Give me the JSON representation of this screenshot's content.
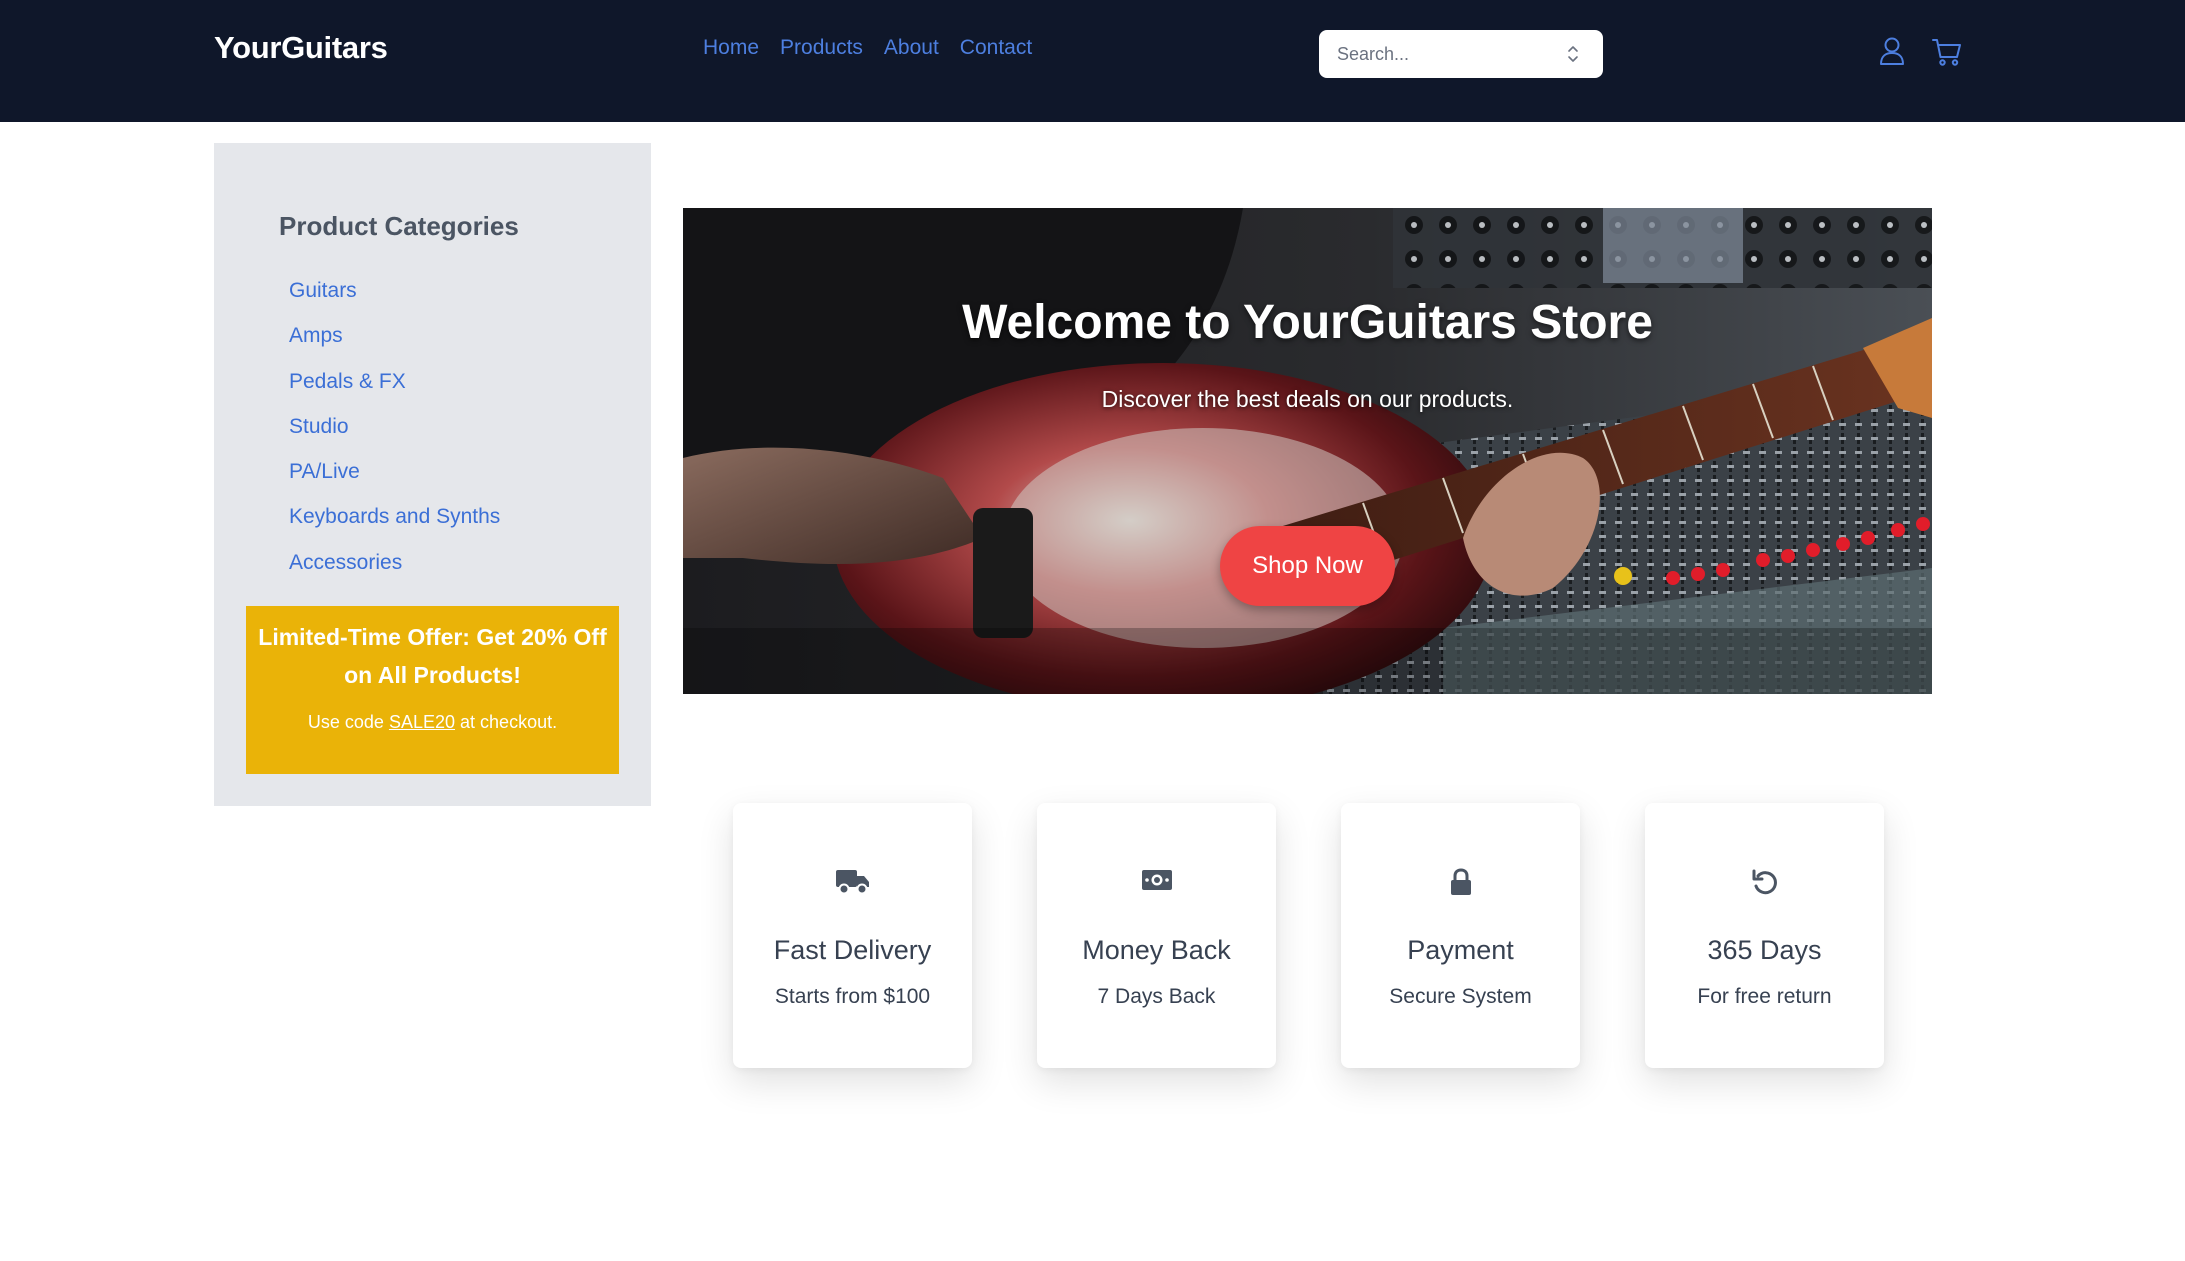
{
  "header": {
    "logo": "YourGuitars",
    "nav": [
      "Home",
      "Products",
      "About",
      "Contact"
    ],
    "search_placeholder": "Search...",
    "icons": [
      "user-icon",
      "cart-icon"
    ]
  },
  "sidebar": {
    "title": "Product Categories",
    "categories": [
      "Guitars",
      "Amps",
      "Pedals & FX",
      "Studio",
      "PA/Live",
      "Keyboards and Synths",
      "Accessories"
    ],
    "offer": {
      "title": "Limited-Time Offer: Get 20% Off on All Products!",
      "prefix": "Use code",
      "code": "SALE20",
      "suffix": "at checkout."
    }
  },
  "hero": {
    "title": "Welcome to YourGuitars Store",
    "subtitle": "Discover the best deals on our products.",
    "button": "Shop Now"
  },
  "features": [
    {
      "icon": "truck-icon",
      "title": "Fast Delivery",
      "subtitle": "Starts from $100"
    },
    {
      "icon": "money-icon",
      "title": "Money Back",
      "subtitle": "7 Days Back"
    },
    {
      "icon": "lock-icon",
      "title": "Payment",
      "subtitle": "Secure System"
    },
    {
      "icon": "undo-icon",
      "title": "365 Days",
      "subtitle": "For free return"
    }
  ],
  "colors": {
    "header_bg": "#0f172a",
    "link": "#4d7fe0",
    "offer_bg": "#eab308",
    "button": "#ef4444"
  }
}
